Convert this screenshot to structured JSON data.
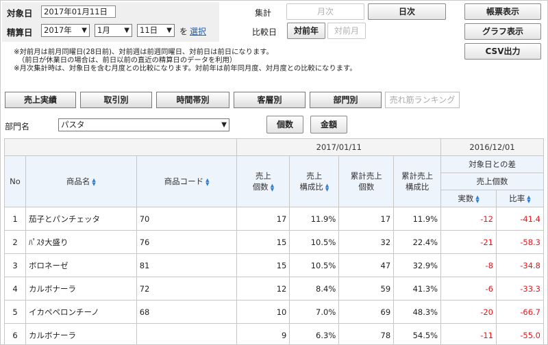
{
  "target": {
    "label": "対象日",
    "value": "2017年01月11日"
  },
  "settle": {
    "label": "精算日",
    "year": "2017年",
    "month": "1月",
    "day": "11日",
    "suffix": "を",
    "select_link": "選択"
  },
  "aggregate": {
    "label": "集計",
    "monthly": "月次",
    "daily": "日次"
  },
  "compare": {
    "label": "比較日",
    "prev_year": "対前年",
    "prev_month": "対前月"
  },
  "side_buttons": {
    "report": "帳票表示",
    "graph": "グラフ表示",
    "csv": "CSV出力"
  },
  "notes": [
    "※対前月は前月同曜日(28日前)、対前週は前週同曜日、対前日は前日になります。",
    "（前日が休業日の場合は、前日以前の直近の精算日のデータを利用）",
    "※月次集計時は、対象日を含む月度との比較になります。対前年は前年同月度、対月度との比較になります。"
  ],
  "tabs": [
    "売上実績",
    "取引別",
    "時間帯別",
    "客層別",
    "部門別",
    "売れ筋ランキング"
  ],
  "dept": {
    "label": "部門名",
    "value": "パスタ",
    "btn_count": "個数",
    "btn_amount": "金額"
  },
  "table": {
    "date_current": "2017/01/11",
    "date_compare": "2016/12/01",
    "diff_label": "対象日との差",
    "diff_sub": "売上個数",
    "headers": {
      "no": "No",
      "name": "商品名",
      "code": "商品コード",
      "qty": "売上\n個数",
      "ratio": "売上\n構成比",
      "cum_qty": "累計売上\n個数",
      "cum_ratio": "累計売上\n構成比",
      "actual": "実数",
      "rate": "比率"
    },
    "rows": [
      {
        "no": "1",
        "name": "茄子とパンチェッタ",
        "code": "70",
        "qty": "17",
        "ratio": "11.9%",
        "cum_qty": "17",
        "cum_ratio": "11.9%",
        "actual": "-12",
        "rate": "-41.4"
      },
      {
        "no": "2",
        "name": "ﾊﾟｽﾀ大盛り",
        "code": "76",
        "qty": "15",
        "ratio": "10.5%",
        "cum_qty": "32",
        "cum_ratio": "22.4%",
        "actual": "-21",
        "rate": "-58.3"
      },
      {
        "no": "3",
        "name": "ボロネーゼ",
        "code": "81",
        "qty": "15",
        "ratio": "10.5%",
        "cum_qty": "47",
        "cum_ratio": "32.9%",
        "actual": "-8",
        "rate": "-34.8"
      },
      {
        "no": "4",
        "name": "カルボナーラ",
        "code": "72",
        "qty": "12",
        "ratio": "8.4%",
        "cum_qty": "59",
        "cum_ratio": "41.3%",
        "actual": "-6",
        "rate": "-33.3"
      },
      {
        "no": "5",
        "name": "イカペペロンチーノ",
        "code": "68",
        "qty": "10",
        "ratio": "7.0%",
        "cum_qty": "69",
        "cum_ratio": "48.3%",
        "actual": "-20",
        "rate": "-66.7"
      },
      {
        "no": "6",
        "name": "カルボナーラ",
        "code": "",
        "qty": "9",
        "ratio": "6.3%",
        "cum_qty": "78",
        "cum_ratio": "54.5%",
        "actual": "-11",
        "rate": "-55.0"
      }
    ]
  },
  "colors": {
    "negative": "#e8171d",
    "link": "#1a5fc0",
    "sort_icon": "#2f7fd6"
  }
}
